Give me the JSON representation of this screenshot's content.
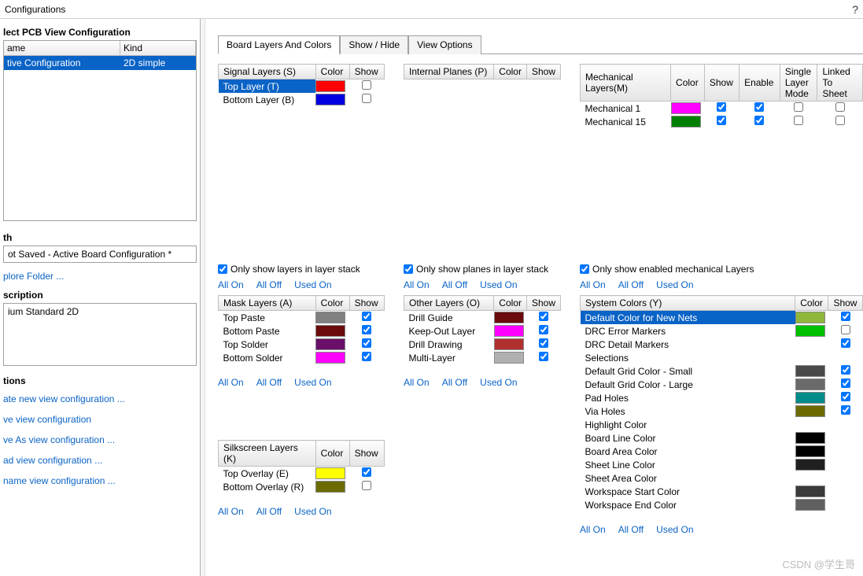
{
  "window": {
    "title": "Configurations",
    "help": "?"
  },
  "sidebar": {
    "select_heading": "lect PCB View Configuration",
    "cols": {
      "name": "ame",
      "kind": "Kind"
    },
    "row": {
      "name": "tive Configuration",
      "kind": "2D simple"
    },
    "path_heading": "th",
    "path_text": "ot Saved - Active Board Configuration *",
    "explore": "plore Folder ...",
    "desc_heading": "scription",
    "desc_text": "ium Standard 2D",
    "actions_heading": "tions",
    "action1": "ate new view configuration ...",
    "action2": "ve view configuration",
    "action3": "ve As view configuration ...",
    "action4": "ad view configuration ...",
    "action5": "name view configuration ..."
  },
  "tabs": [
    "Board Layers And Colors",
    "Show / Hide",
    "View Options"
  ],
  "labels": {
    "only_stack": "Only show layers in layer stack",
    "only_planes": "Only show planes in layer stack",
    "only_mech": "Only show enabled mechanical Layers",
    "all_on": "All On",
    "all_off": "All Off",
    "used_on": "Used On"
  },
  "signal": {
    "heads": [
      "Signal Layers (S)",
      "Color",
      "Show"
    ],
    "rows": [
      {
        "name": "Top Layer (T)",
        "color": "#ff0000",
        "show": false,
        "sel": true
      },
      {
        "name": "Bottom Layer (B)",
        "color": "#0000e0",
        "show": false
      }
    ]
  },
  "planes": {
    "heads": [
      "Internal Planes (P)",
      "Color",
      "Show"
    ],
    "rows": []
  },
  "mech": {
    "heads": [
      "Mechanical Layers(M)",
      "Color",
      "Show",
      "Enable",
      "Single Layer Mode",
      "Linked To Sheet"
    ],
    "rows": [
      {
        "name": "Mechanical 1",
        "color": "#ff00ff",
        "show": true,
        "enable": true,
        "single": false,
        "linked": false
      },
      {
        "name": "Mechanical 15",
        "color": "#008000",
        "show": true,
        "enable": true,
        "single": false,
        "linked": false
      }
    ]
  },
  "mask": {
    "heads": [
      "Mask Layers (A)",
      "Color",
      "Show"
    ],
    "rows": [
      {
        "name": "Top Paste",
        "color": "#808080",
        "show": true
      },
      {
        "name": "Bottom Paste",
        "color": "#6b0b0b",
        "show": true
      },
      {
        "name": "Top Solder",
        "color": "#6a0f6a",
        "show": true
      },
      {
        "name": "Bottom Solder",
        "color": "#ff00ff",
        "show": true
      }
    ]
  },
  "other": {
    "heads": [
      "Other Layers (O)",
      "Color",
      "Show"
    ],
    "rows": [
      {
        "name": "Drill Guide",
        "color": "#6b0b0b",
        "show": true
      },
      {
        "name": "Keep-Out Layer",
        "color": "#ff00ff",
        "show": true
      },
      {
        "name": "Drill Drawing",
        "color": "#b03030",
        "show": true
      },
      {
        "name": "Multi-Layer",
        "color": "#b0b0b0",
        "show": true
      }
    ]
  },
  "silk": {
    "heads": [
      "Silkscreen Layers (K)",
      "Color",
      "Show"
    ],
    "rows": [
      {
        "name": "Top Overlay (E)",
        "color": "#ffff00",
        "show": true
      },
      {
        "name": "Bottom Overlay (R)",
        "color": "#6b6b00",
        "show": false
      }
    ]
  },
  "syscolors": {
    "heads": [
      "System Colors (Y)",
      "Color",
      "Show"
    ],
    "rows": [
      {
        "name": "Default Color for New Nets",
        "color": "#8fb73a",
        "show": true,
        "sel": true
      },
      {
        "name": "DRC Error Markers",
        "color": "#00c000",
        "show": false
      },
      {
        "name": "DRC Detail Markers",
        "color": "",
        "show": true,
        "noswatch": true
      },
      {
        "name": "Selections",
        "color": "",
        "noswatch": true,
        "noshow": true
      },
      {
        "name": "Default Grid Color - Small",
        "color": "#4a4a4a",
        "show": true
      },
      {
        "name": "Default Grid Color - Large",
        "color": "#6a6a6a",
        "show": true
      },
      {
        "name": "Pad Holes",
        "color": "#008b8b",
        "show": true
      },
      {
        "name": "Via Holes",
        "color": "#6b6b00",
        "show": true
      },
      {
        "name": "Highlight Color",
        "color": "",
        "noswatch": true,
        "noshow": true
      },
      {
        "name": "Board Line Color",
        "color": "#000000",
        "noshow": true
      },
      {
        "name": "Board Area Color",
        "color": "#000000",
        "noshow": true
      },
      {
        "name": "Sheet Line Color",
        "color": "#202020",
        "noshow": true
      },
      {
        "name": "Sheet Area Color",
        "color": "",
        "noswatch": true,
        "noshow": true
      },
      {
        "name": "Workspace Start Color",
        "color": "#3a3a3a",
        "noshow": true
      },
      {
        "name": "Workspace End Color",
        "color": "#606060",
        "noshow": true
      }
    ]
  },
  "watermark": "CSDN @学生哥"
}
